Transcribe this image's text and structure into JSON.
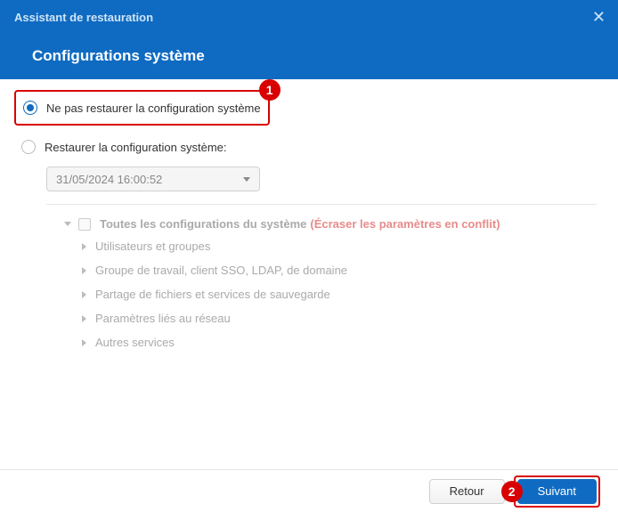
{
  "header": {
    "wizard_title": "Assistant de restauration",
    "page_title": "Configurations système"
  },
  "options": {
    "no_restore": "Ne pas restaurer la configuration système",
    "restore": "Restaurer la configuration système:"
  },
  "dropdown": {
    "value": "31/05/2024 16:00:52"
  },
  "tree": {
    "root_label": "Toutes les configurations du système",
    "root_note": "(Écraser les paramètres en conflit)",
    "items": [
      "Utilisateurs et groupes",
      "Groupe de travail, client SSO, LDAP, de domaine",
      "Partage de fichiers et services de sauvegarde",
      "Paramètres liés au réseau",
      "Autres services"
    ]
  },
  "footer": {
    "back": "Retour",
    "next": "Suivant"
  },
  "badges": {
    "one": "1",
    "two": "2"
  }
}
